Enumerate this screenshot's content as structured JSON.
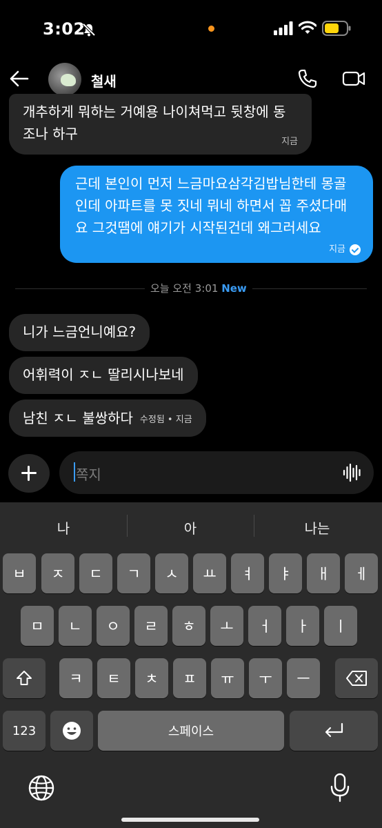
{
  "status_bar": {
    "time": "3:02"
  },
  "header": {
    "contact_name": "철새"
  },
  "messages": [
    {
      "direction": "in",
      "lines": [
        "개추하게 뭐하는 거예용 나이쳐먹고 뒷창에 동",
        "조나 하구"
      ],
      "time": "지금"
    },
    {
      "direction": "out",
      "lines": [
        "근데 본인이 먼저 느금마요삼각김밥님한테 몽골",
        "인데 아파트를 못 짓네 뭐네 하면서 꼽 주셨다매",
        "요 그것땜에 얘기가 시작된건데  왜그러세요"
      ],
      "time": "지금"
    }
  ],
  "divider": {
    "text": "오늘 오전 3:01",
    "badge": "New"
  },
  "new_messages": [
    {
      "text": "니가 느금언니예요?"
    },
    {
      "text": "어휘력이 ㅈㄴ 딸리시나보네"
    },
    {
      "text": "남친 ㅈㄴ 불쌍하다",
      "meta": "수정됨 • 지금"
    }
  ],
  "composer": {
    "placeholder": "쪽지"
  },
  "keyboard": {
    "suggestions": [
      "나",
      "아",
      "나는"
    ],
    "row1": [
      "ㅂ",
      "ㅈ",
      "ㄷ",
      "ㄱ",
      "ㅅ",
      "ㅛ",
      "ㅕ",
      "ㅑ",
      "ㅐ",
      "ㅔ"
    ],
    "row2": [
      "ㅁ",
      "ㄴ",
      "ㅇ",
      "ㄹ",
      "ㅎ",
      "ㅗ",
      "ㅓ",
      "ㅏ",
      "ㅣ"
    ],
    "row3": [
      "ㅋ",
      "ㅌ",
      "ㅊ",
      "ㅍ",
      "ㅠ",
      "ㅜ",
      "ㅡ"
    ],
    "numbers_label": "123",
    "space_label": "스페이스"
  }
}
